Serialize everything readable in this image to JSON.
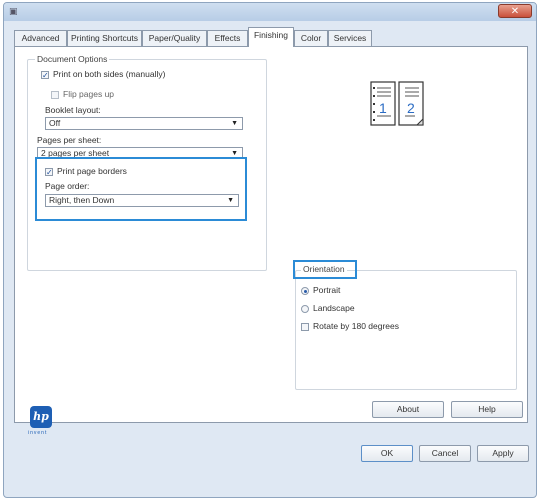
{
  "window": {
    "title": ""
  },
  "tabs": [
    {
      "label": "Advanced"
    },
    {
      "label": "Printing Shortcuts"
    },
    {
      "label": "Paper/Quality"
    },
    {
      "label": "Effects"
    },
    {
      "label": "Finishing"
    },
    {
      "label": "Color"
    },
    {
      "label": "Services"
    }
  ],
  "active_tab": "Finishing",
  "document_options": {
    "legend": "Document Options",
    "print_both_sides": {
      "label": "Print on both sides (manually)",
      "checked": true
    },
    "flip_pages_up": {
      "label": "Flip pages up",
      "checked": false
    },
    "booklet_layout": {
      "label": "Booklet layout:",
      "value": "Off"
    },
    "pages_per_sheet": {
      "label": "Pages per sheet:",
      "value": "2 pages per sheet"
    },
    "print_page_borders": {
      "label": "Print page borders",
      "checked": true
    },
    "page_order": {
      "label": "Page order:",
      "value": "Right, then Down"
    }
  },
  "orientation": {
    "legend": "Orientation",
    "portrait": {
      "label": "Portrait",
      "selected": true
    },
    "landscape": {
      "label": "Landscape",
      "selected": false
    },
    "rotate": {
      "label": "Rotate by 180 degrees",
      "checked": false
    }
  },
  "preview": {
    "page1": "1",
    "page2": "2"
  },
  "branding": {
    "logo_text": "hp",
    "logo_sub": "invent"
  },
  "buttons": {
    "about": "About",
    "help": "Help",
    "ok": "OK",
    "cancel": "Cancel",
    "apply": "Apply"
  },
  "colors": {
    "highlight": "#2b8bd6",
    "hp_blue": "#1e5fb4",
    "close_red": "#c9503a"
  }
}
